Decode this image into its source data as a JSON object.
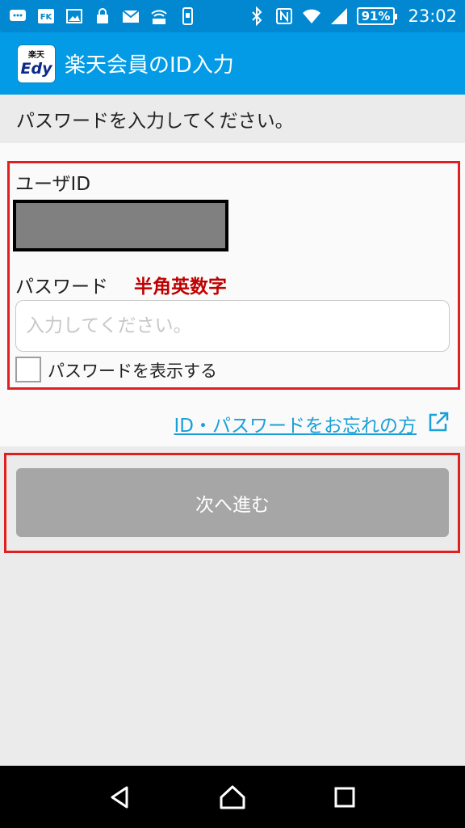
{
  "status_bar": {
    "left_icons": [
      "message-icon",
      "fk-icon",
      "image-icon",
      "lock-icon",
      "mail-icon",
      "wifi-transfer-icon",
      "phone-icon"
    ],
    "battery": "91%",
    "time": "23:02"
  },
  "app_bar": {
    "logo_top": "楽天",
    "logo_bottom": "Edy",
    "title": "楽天会員のID入力"
  },
  "subtitle": "パスワードを入力してください。",
  "form": {
    "user_id_label": "ユーザID",
    "password_label": "パスワード",
    "password_note": "半角英数字",
    "password_placeholder": "入力してください。",
    "show_password_label": "パスワードを表示する"
  },
  "forgot_link": "ID・パスワードをお忘れの方",
  "next_button": "次へ進む",
  "colors": {
    "status_bar": "#0288d1",
    "app_bar": "#039be5",
    "highlight": "#e02020",
    "note_red": "#c00000",
    "link": "#1a9fd8",
    "button_disabled": "#a6a6a6"
  }
}
